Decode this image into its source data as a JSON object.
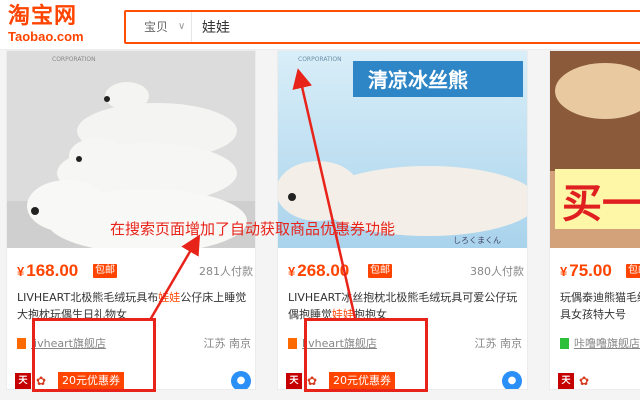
{
  "header": {
    "logo_cn": "淘宝网",
    "logo_en": "Taobao.com",
    "search_category": "宝贝",
    "search_value": "娃娃"
  },
  "products": [
    {
      "img_text": "CORPORATION",
      "price": "168.00",
      "currency": "¥",
      "shipping_badge": "包邮",
      "sales": "281人付款",
      "title_before": "LIVHEART北极熊毛绒玩具布",
      "title_hl": "娃娃",
      "title_after": "公仔床上睡觉大抱枕玩偶生日礼物女",
      "shop": "livheart旗舰店",
      "location": "江苏 南京",
      "coupon": "20元优惠券"
    },
    {
      "img_text": "CORPORATION",
      "img_banner": "清凉冰丝熊",
      "img_caption": "しろくまくん",
      "price": "268.00",
      "currency": "¥",
      "shipping_badge": "包邮",
      "sales": "380人付款",
      "title_before": "LIVHEART冰丝抱枕北极熊毛绒玩具可爱公仔玩偶抱睡觉",
      "title_hl": "娃娃",
      "title_after": "抱抱女",
      "shop": "livheart旗舰店",
      "location": "江苏 南京"
    },
    {
      "img_banner": "买一",
      "price": "75.00",
      "currency": "¥",
      "shipping_badge": "包邮",
      "title_before": "玩偶泰迪熊猫毛绒玩具女孩特大号",
      "shop": "咔噜噜旗舰店"
    }
  ],
  "annotation": {
    "text": "在搜索页面增加了自动获取商品优惠券功能"
  },
  "colors": {
    "brand": "#ff4400",
    "annotation": "#e8231a"
  },
  "icons": [
    "tmall-icon",
    "gift-icon",
    "wangwang-icon",
    "chevron-down-icon"
  ]
}
